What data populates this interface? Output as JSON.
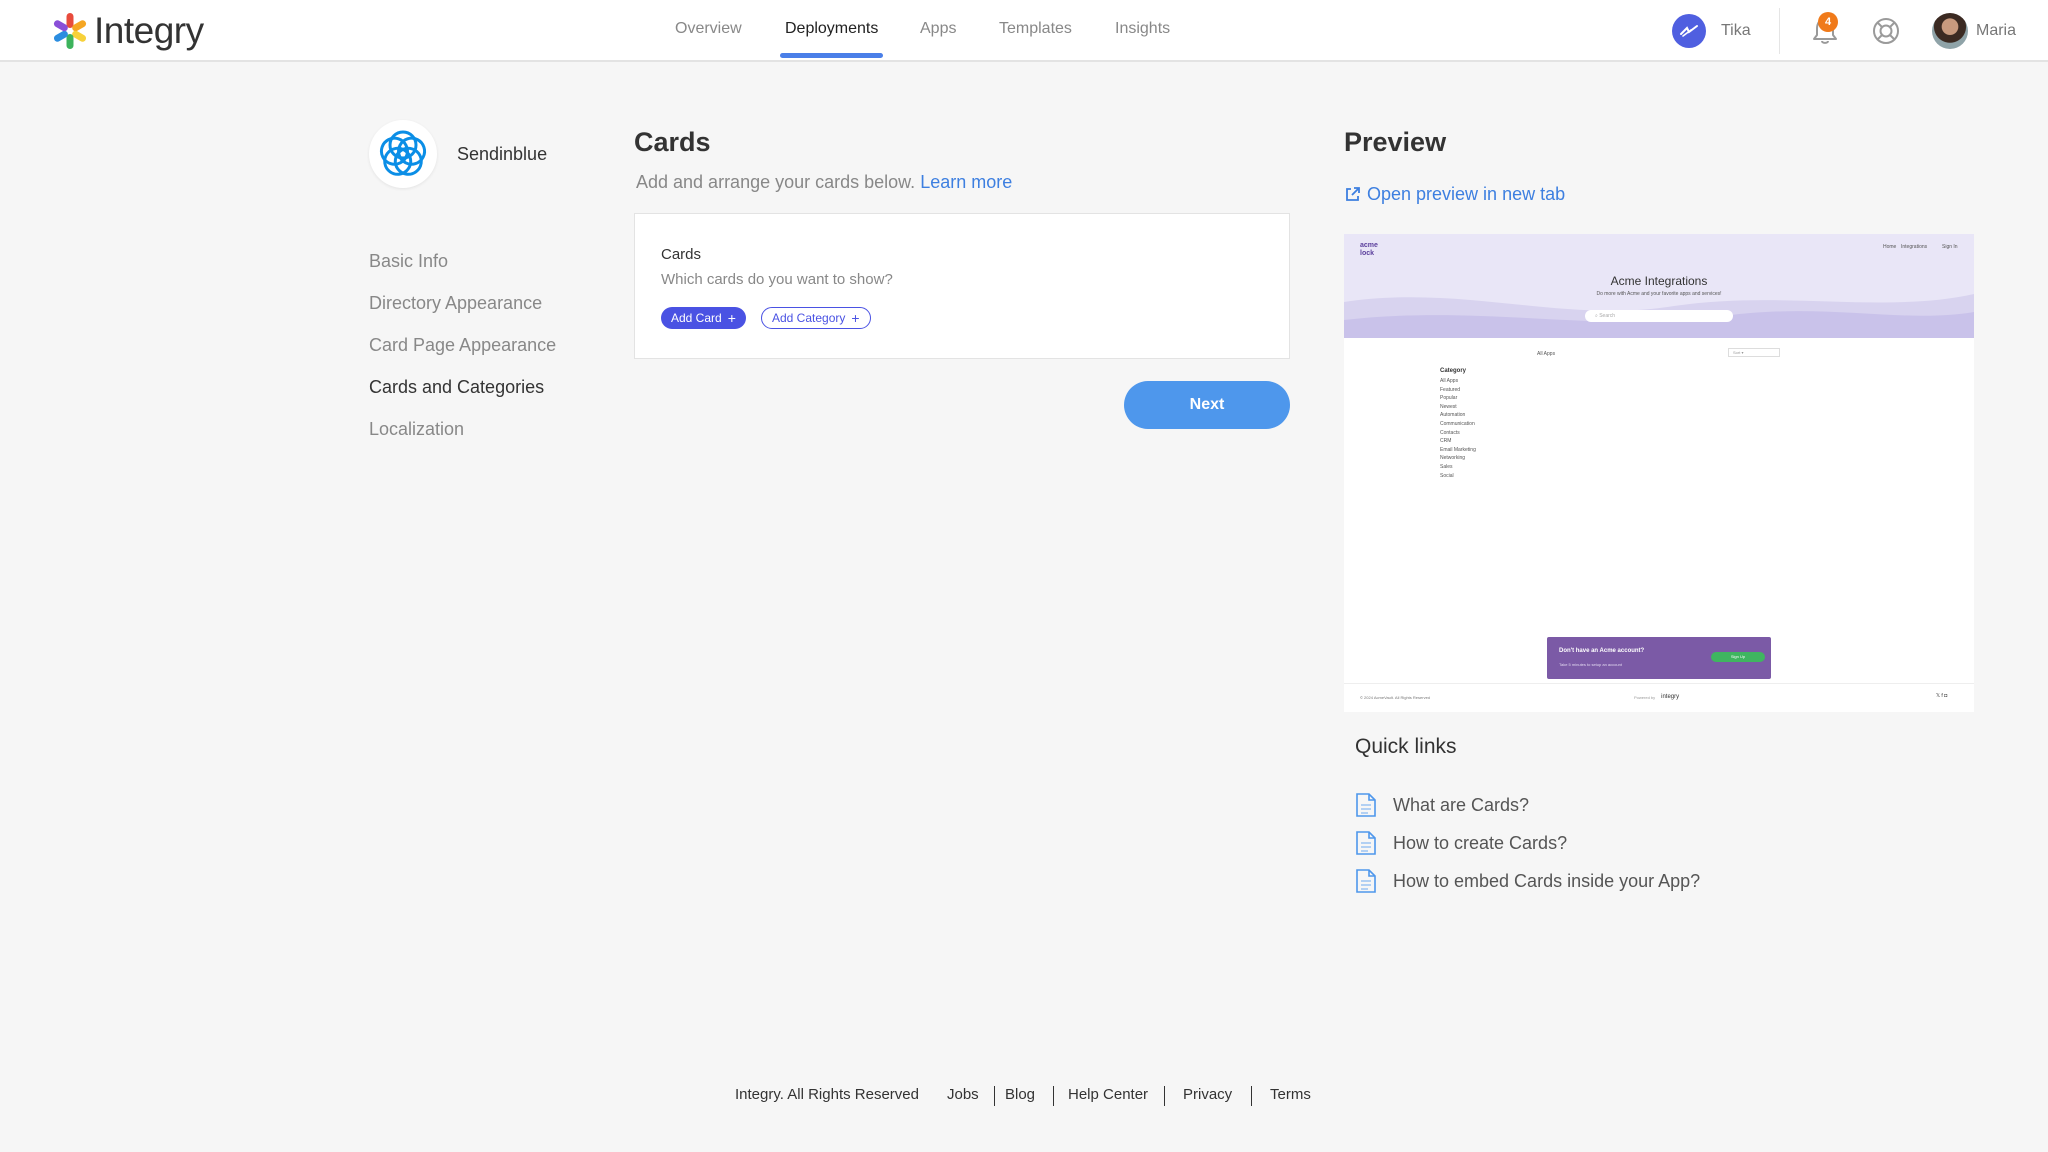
{
  "header": {
    "logo_text": "Integry",
    "nav": [
      {
        "label": "Overview",
        "active": false
      },
      {
        "label": "Deployments",
        "active": true
      },
      {
        "label": "Apps",
        "active": false
      },
      {
        "label": "Templates",
        "active": false
      },
      {
        "label": "Insights",
        "active": false
      }
    ],
    "account_name": "Tika",
    "notification_count": "4",
    "user_name": "Maria"
  },
  "sidebar": {
    "brand_name": "Sendinblue",
    "items": [
      {
        "label": "Basic Info",
        "active": false
      },
      {
        "label": "Directory Appearance",
        "active": false
      },
      {
        "label": "Card Page Appearance",
        "active": false
      },
      {
        "label": "Cards and Categories",
        "active": true
      },
      {
        "label": "Localization",
        "active": false
      }
    ]
  },
  "main": {
    "title": "Cards",
    "subtitle": "Add and arrange your cards below.",
    "learn_more": "Learn more",
    "card_box": {
      "title": "Cards",
      "subtitle": "Which cards do you want to show?",
      "add_card_label": "Add Card",
      "add_category_label": "Add Category"
    },
    "next_label": "Next"
  },
  "preview": {
    "title": "Preview",
    "open_link": "Open preview in new tab",
    "mock": {
      "logo_top": "acme",
      "logo_bottom": "lock",
      "menu": [
        "Home",
        "Integrations",
        "Sign In"
      ],
      "title": "Acme Integrations",
      "tagline": "Do more with Acme and your favorite apps and services!",
      "search_placeholder": "Search",
      "all_apps": "All Apps",
      "select_value": "Sort",
      "category_heading": "Category",
      "categories": [
        "All Apps",
        "Featured",
        "Popular",
        "Newest",
        "Automation",
        "Communication",
        "Contacts",
        "CRM",
        "Email Marketing",
        "Networking",
        "Sales",
        "Social"
      ],
      "cta_title": "Don't have an Acme account?",
      "cta_sub": "Take 5 minutes to setup an account",
      "cta_button": "Sign Up",
      "copyright": "© 2024 AcmeVault. All Rights Reserved",
      "powered_by": "Powered by",
      "powered_brand": "integry",
      "social": "𝕏  f  ◘"
    }
  },
  "quick_links": {
    "title": "Quick links",
    "items": [
      "What are Cards?",
      "How to create Cards?",
      "How to embed Cards inside your App?"
    ]
  },
  "footer": {
    "copyright": "Integry. All Rights Reserved",
    "links": [
      "Jobs",
      "Blog",
      "Help Center",
      "Privacy",
      "Terms"
    ]
  },
  "colors": {
    "accent": "#4a7fe8",
    "primary_button": "#4e97ec",
    "add_card": "#4a52e3",
    "badge": "#f07a1a",
    "preview_cta": "#7b5aa6"
  }
}
